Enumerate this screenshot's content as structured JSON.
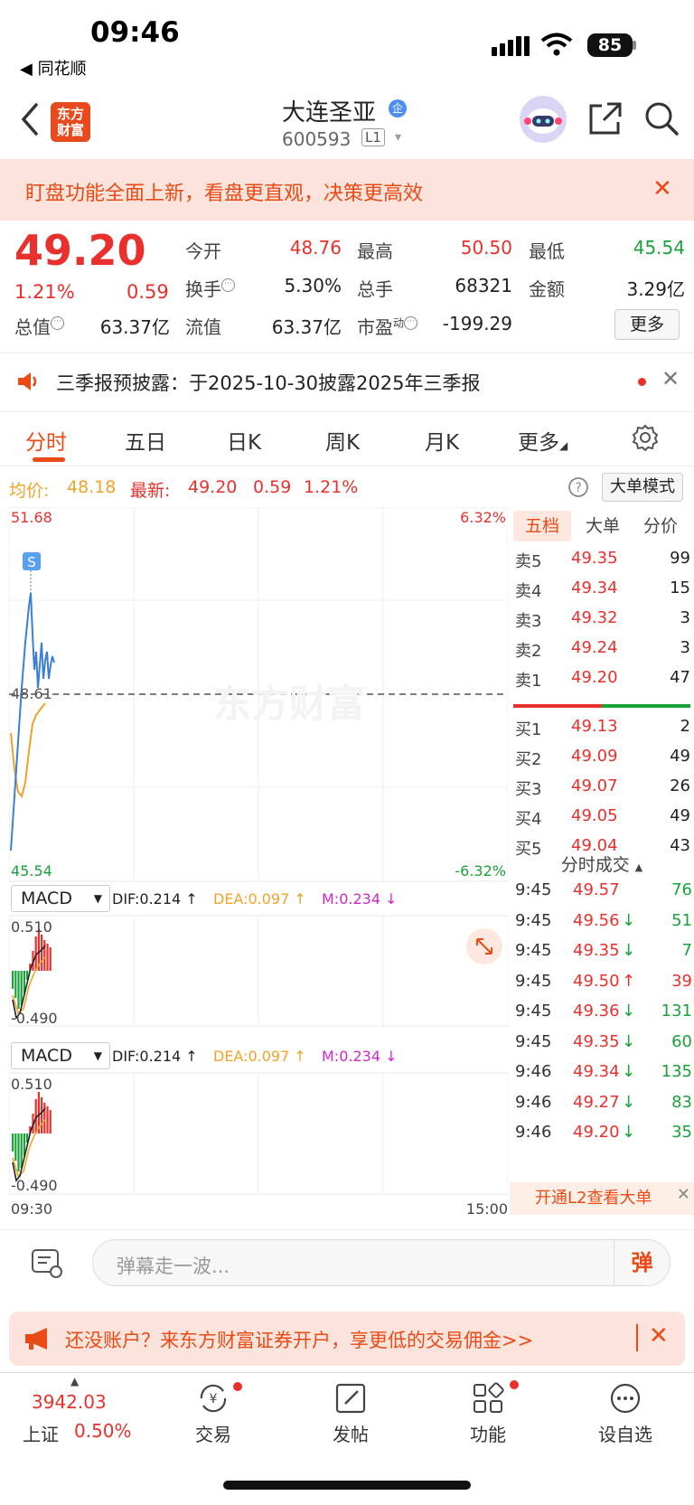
{
  "status_bar": {
    "time": "09:46",
    "back_app": "◀ 同花顺",
    "battery": "85"
  },
  "nav": {
    "logo_text": "东方财富",
    "stock_name": "大连圣亚",
    "badge": "企",
    "stock_code": "600593",
    "level": "L1"
  },
  "banner": {
    "text": "盯盘功能全面上新，看盘更直观，决策更高效"
  },
  "quote": {
    "price": "49.20",
    "change_pct": "1.21%",
    "change": "0.59",
    "fields": [
      {
        "label": "今开",
        "value": "48.76",
        "color": "red"
      },
      {
        "label": "最高",
        "value": "50.50",
        "color": "red"
      },
      {
        "label": "最低",
        "value": "45.54",
        "color": "green"
      },
      {
        "label": "换手",
        "value": "5.30%",
        "color": "black"
      },
      {
        "label": "总手",
        "value": "68321",
        "color": "black"
      },
      {
        "label": "金额",
        "value": "3.29亿",
        "color": "black"
      },
      {
        "label": "总值",
        "value": "63.37亿",
        "color": "black"
      },
      {
        "label": "流值",
        "value": "63.37亿",
        "color": "black"
      },
      {
        "label": "市盈",
        "value": "-199.29",
        "color": "black"
      }
    ],
    "pe_superscript": "动",
    "more_label": "更多"
  },
  "notice": {
    "text": "三季报预披露：于2025-10-30披露2025年三季报"
  },
  "tabs": [
    "分时",
    "五日",
    "日K",
    "周K",
    "月K",
    "更多"
  ],
  "info": {
    "avg_label": "均价:",
    "avg_value": "48.18",
    "latest_label": "最新:",
    "latest_value": "49.20",
    "latest_change": "0.59",
    "latest_pct": "1.21%",
    "mode_button": "大单模式"
  },
  "chart": {
    "price_high": "51.68",
    "price_low": "45.54",
    "pct_high": "6.32%",
    "pct_low": "-6.32%",
    "base": "48.61",
    "watermark": "东方财富",
    "s_marker": "S",
    "time_start": "09:30",
    "time_end": "15:00",
    "macd": [
      {
        "name": "MACD",
        "dif": "DIF:0.214 ↑",
        "dea": "DEA:0.097 ↑",
        "m": "M:0.234 ↓",
        "max": "0.510",
        "min": "-0.490"
      },
      {
        "name": "MACD",
        "dif": "DIF:0.214 ↑",
        "dea": "DEA:0.097 ↑",
        "m": "M:0.234 ↓",
        "max": "0.510",
        "min": "-0.490"
      }
    ]
  },
  "orderbook": {
    "tabs": [
      "五档",
      "大单",
      "分价"
    ],
    "sell": [
      {
        "label": "卖5",
        "price": "49.35",
        "vol": "99"
      },
      {
        "label": "卖4",
        "price": "49.34",
        "vol": "15"
      },
      {
        "label": "卖3",
        "price": "49.32",
        "vol": "3"
      },
      {
        "label": "卖2",
        "price": "49.24",
        "vol": "3"
      },
      {
        "label": "卖1",
        "price": "49.20",
        "vol": "47"
      }
    ],
    "buy": [
      {
        "label": "买1",
        "price": "49.13",
        "vol": "2"
      },
      {
        "label": "买2",
        "price": "49.09",
        "vol": "49"
      },
      {
        "label": "买3",
        "price": "49.07",
        "vol": "26"
      },
      {
        "label": "买4",
        "price": "49.05",
        "vol": "49"
      },
      {
        "label": "买5",
        "price": "49.04",
        "vol": "43"
      }
    ]
  },
  "trades": {
    "title": "分时成交",
    "rows": [
      {
        "time": "9:45",
        "price": "49.57",
        "arrow": "",
        "vol": "76",
        "dir": "green"
      },
      {
        "time": "9:45",
        "price": "49.56",
        "arrow": "↓",
        "vol": "51",
        "dir": "green"
      },
      {
        "time": "9:45",
        "price": "49.35",
        "arrow": "↓",
        "vol": "7",
        "dir": "green"
      },
      {
        "time": "9:45",
        "price": "49.50",
        "arrow": "↑",
        "vol": "39",
        "dir": "red"
      },
      {
        "time": "9:45",
        "price": "49.36",
        "arrow": "↓",
        "vol": "131",
        "dir": "green"
      },
      {
        "time": "9:45",
        "price": "49.35",
        "arrow": "↓",
        "vol": "60",
        "dir": "green"
      },
      {
        "time": "9:46",
        "price": "49.34",
        "arrow": "↓",
        "vol": "135",
        "dir": "green"
      },
      {
        "time": "9:46",
        "price": "49.27",
        "arrow": "↓",
        "vol": "83",
        "dir": "green"
      },
      {
        "time": "9:46",
        "price": "49.20",
        "arrow": "↓",
        "vol": "35",
        "dir": "green"
      }
    ],
    "open_l2": "开通L2查看大单"
  },
  "comment": {
    "placeholder": "弹幕走一波...",
    "danmu_label": "弹"
  },
  "promo": {
    "text": "还没账户？来东方财富证券开户，享更低的交易佣金>>"
  },
  "bottom_nav": {
    "index_value": "3942.03",
    "index_name": "上证",
    "index_pct": "0.50%",
    "items": [
      "交易",
      "发帖",
      "功能",
      "设自选"
    ]
  },
  "colors": {
    "up": "#e8312c",
    "down": "#1aa23a",
    "accent": "#e94a16",
    "avg_line": "#f0a32a",
    "price_line": "#3b7fd6"
  }
}
